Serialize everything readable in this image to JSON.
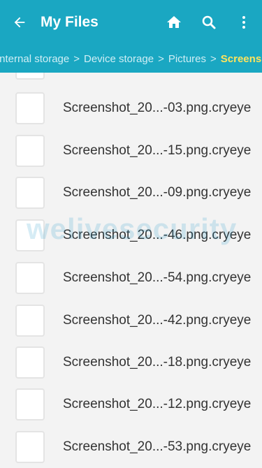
{
  "appbar": {
    "title": "My Files",
    "icons": [
      "back-arrow-icon",
      "home-icon",
      "search-icon",
      "more-vert-icon"
    ],
    "color": "#1aa7c2"
  },
  "breadcrumb": {
    "items": [
      "Internal storage",
      "Device storage",
      "Pictures",
      "Screenshots"
    ],
    "separator": ">",
    "current_color": "#ffe45c"
  },
  "files": [
    "Screenshot_20...-03.png.cryeye",
    "Screenshot_20...-15.png.cryeye",
    "Screenshot_20...-09.png.cryeye",
    "Screenshot_20...-46.png.cryeye",
    "Screenshot_20...-54.png.cryeye",
    "Screenshot_20...-42.png.cryeye",
    "Screenshot_20...-18.png.cryeye",
    "Screenshot_20...-12.png.cryeye",
    "Screenshot_20...-53.png.cryeye"
  ],
  "watermark": "welivesecurity"
}
